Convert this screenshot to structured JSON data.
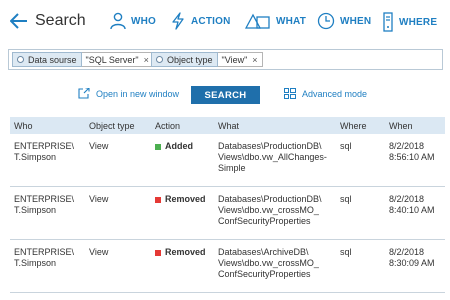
{
  "header": {
    "title": "Search",
    "nav": [
      {
        "label": "WHO",
        "icon": "person-icon"
      },
      {
        "label": "ACTION",
        "icon": "lightning-icon"
      },
      {
        "label": "WHAT",
        "icon": "shapes-icon"
      },
      {
        "label": "WHEN",
        "icon": "clock-icon"
      },
      {
        "label": "WHERE",
        "icon": "server-icon"
      }
    ]
  },
  "filters": [
    {
      "key": "Data sourse",
      "value": "\"SQL Server\""
    },
    {
      "key": "Object type",
      "value": "\"View\""
    }
  ],
  "actions": {
    "open_new_window": "Open in new window",
    "search": "SEARCH",
    "advanced_mode": "Advanced mode"
  },
  "table": {
    "columns": [
      "Who",
      "Object type",
      "Action",
      "What",
      "Where",
      "When"
    ],
    "rows": [
      {
        "who": [
          "ENTERPRISE\\",
          "T.Simpson"
        ],
        "object_type": "View",
        "action": "Added",
        "action_color": "#4caf50",
        "what": [
          "Databases\\ProductionDB\\",
          "Views\\dbo.vw_AllChanges-",
          "Simple"
        ],
        "where": "sql",
        "when": [
          "8/2/2018",
          "8:56:10 AM"
        ]
      },
      {
        "who": [
          "ENTERPRISE\\",
          "T.Simpson"
        ],
        "object_type": "View",
        "action": "Removed",
        "action_color": "#e53935",
        "what": [
          "Databases\\ProductionDB\\",
          "Views\\dbo.vw_crossMO_",
          "ConfSecurityProperties"
        ],
        "where": "sql",
        "when": [
          "8/2/2018",
          "8:40:10 AM"
        ]
      },
      {
        "who": [
          "ENTERPRISE\\",
          "T.Simpson"
        ],
        "object_type": "View",
        "action": "Removed",
        "action_color": "#e53935",
        "what": [
          "Databases\\ArchiveDB\\",
          "Views\\dbo.vw_crossMO_",
          "ConfSecurityProperties"
        ],
        "where": "sql",
        "when": [
          "8/2/2018",
          "8:30:09 AM"
        ]
      }
    ]
  }
}
